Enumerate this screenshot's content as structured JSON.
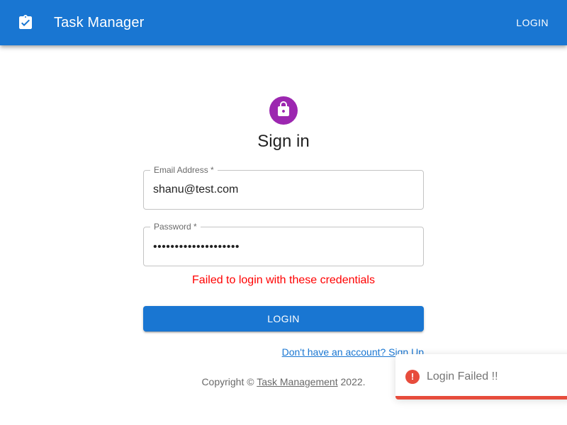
{
  "appbar": {
    "icon": "assignment-turned-in-icon",
    "title": "Task Manager",
    "login_label": "LOGIN"
  },
  "form": {
    "avatar_icon": "lock-icon",
    "heading": "Sign in",
    "email": {
      "label": "Email Address *",
      "value": "shanu@test.com"
    },
    "password": {
      "label": "Password *",
      "value": "••••••••••••••••••••"
    },
    "error": "Failed to login with these credentials",
    "submit_label": "LOGIN",
    "signup_link": "Don't have an account? Sign Up"
  },
  "footer": {
    "prefix": "Copyright © ",
    "link": "Task Management",
    "suffix": " 2022."
  },
  "toast": {
    "icon": "error-icon",
    "message": "Login Failed !!",
    "color": "#e74c3c"
  },
  "colors": {
    "primary": "#1976d2",
    "avatar": "#9c27b0",
    "error": "#ff0000"
  }
}
